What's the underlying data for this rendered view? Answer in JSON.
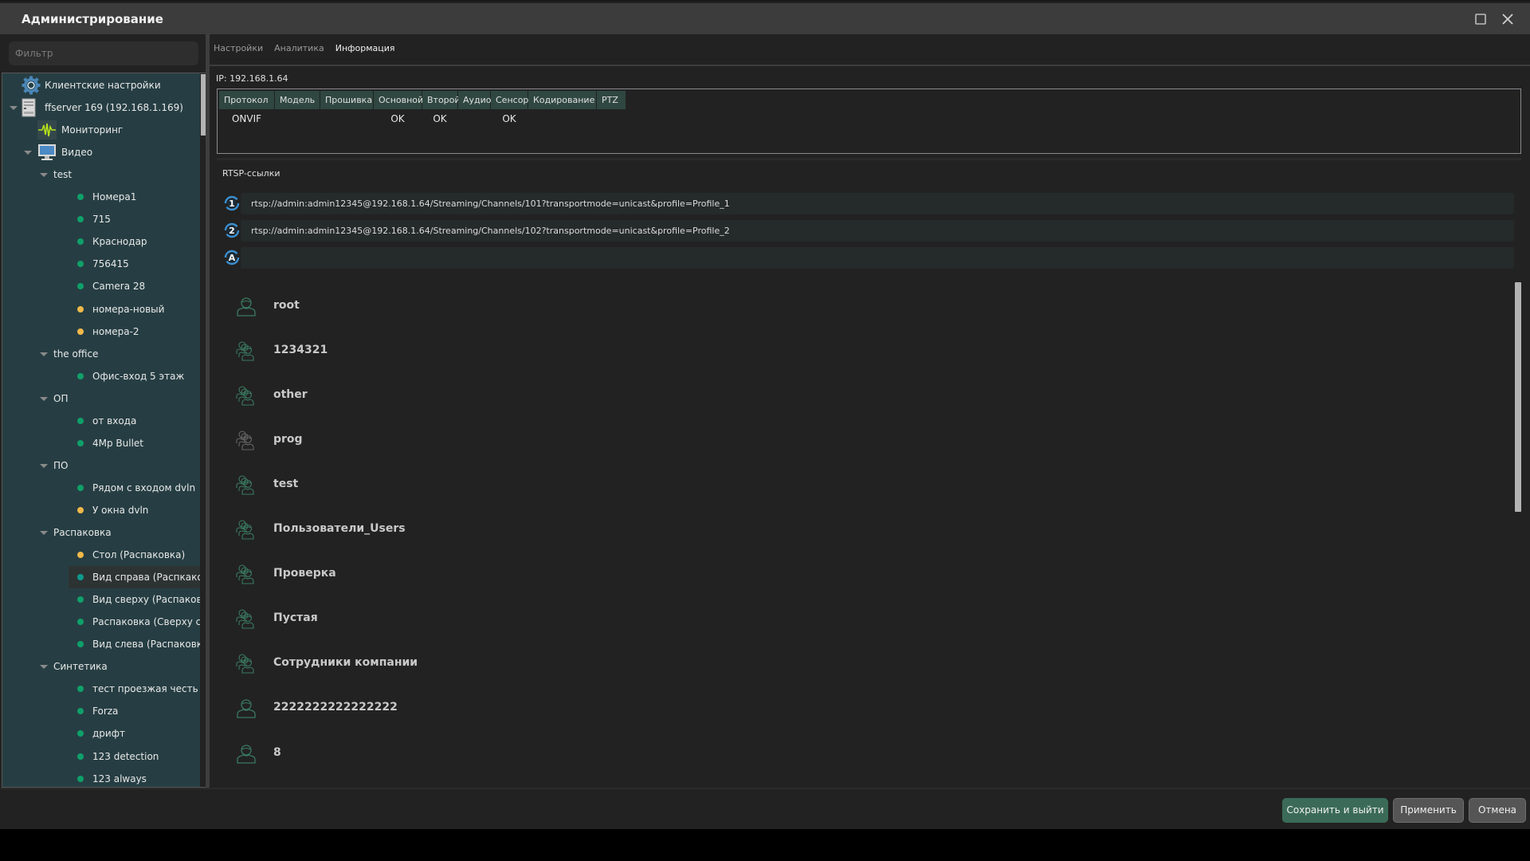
{
  "window": {
    "title": "Администрирование"
  },
  "sidebar": {
    "filter_placeholder": "Фильтр",
    "tree": [
      {
        "label": "Клиентские настройки",
        "type": "settings",
        "level": 0
      },
      {
        "label": "ffserver 169 (192.168.1.169)",
        "type": "server",
        "level": 0,
        "expanded": true
      },
      {
        "label": "Мониторинг",
        "type": "monitoring",
        "level": 1
      },
      {
        "label": "Видео",
        "type": "video",
        "level": 1,
        "expanded": true
      },
      {
        "label": "test",
        "type": "group",
        "level": 2,
        "expanded": true
      },
      {
        "label": "Номера1",
        "type": "camera",
        "status": "online",
        "level": 3
      },
      {
        "label": "715",
        "type": "camera",
        "status": "online",
        "level": 3
      },
      {
        "label": "Краснодар",
        "type": "camera",
        "status": "online",
        "level": 3
      },
      {
        "label": "756415",
        "type": "camera",
        "status": "online",
        "level": 3
      },
      {
        "label": "Camera 28",
        "type": "camera",
        "status": "online",
        "level": 3
      },
      {
        "label": "номера-новый",
        "type": "camera",
        "status": "warning",
        "level": 3
      },
      {
        "label": "номера-2",
        "type": "camera",
        "status": "warning",
        "level": 3
      },
      {
        "label": "the office",
        "type": "group",
        "level": 2,
        "expanded": true
      },
      {
        "label": "Офис-вход 5 этаж",
        "type": "camera",
        "status": "online",
        "level": 3
      },
      {
        "label": "ОП",
        "type": "group",
        "level": 2,
        "expanded": true
      },
      {
        "label": "от входа",
        "type": "camera",
        "status": "online",
        "level": 3
      },
      {
        "label": "4Mp Bullet",
        "type": "camera",
        "status": "online",
        "level": 3
      },
      {
        "label": "ПО",
        "type": "group",
        "level": 2,
        "expanded": true
      },
      {
        "label": "Рядом с входом dvln",
        "type": "camera",
        "status": "online",
        "level": 3
      },
      {
        "label": "У окна dvln",
        "type": "camera",
        "status": "warning",
        "level": 3
      },
      {
        "label": "Распаковка",
        "type": "group",
        "level": 2,
        "expanded": true
      },
      {
        "label": "Стол (Распаковка)",
        "type": "camera",
        "status": "warning",
        "level": 3
      },
      {
        "label": "Вид справа (Распкако...",
        "type": "camera",
        "status": "selected",
        "level": 3,
        "selected": true
      },
      {
        "label": "Вид сверху (Распаков...",
        "type": "camera",
        "status": "online",
        "level": 3
      },
      {
        "label": "Распаковка (Сверху с...",
        "type": "camera",
        "status": "online",
        "level": 3
      },
      {
        "label": "Вид слева (Распаковк...",
        "type": "camera",
        "status": "online",
        "level": 3
      },
      {
        "label": "Синтетика",
        "type": "group",
        "level": 2,
        "expanded": true
      },
      {
        "label": "тест проезжая честь",
        "type": "camera",
        "status": "online",
        "level": 3
      },
      {
        "label": "Forza",
        "type": "camera",
        "status": "online",
        "level": 3
      },
      {
        "label": "дрифт",
        "type": "camera",
        "status": "online",
        "level": 3
      },
      {
        "label": "123 detection",
        "type": "camera",
        "status": "online",
        "level": 3
      },
      {
        "label": "123 always",
        "type": "camera",
        "status": "online",
        "level": 3
      }
    ]
  },
  "tabs": [
    {
      "label": "Настройки",
      "active": false
    },
    {
      "label": "Аналитика",
      "active": false
    },
    {
      "label": "Информация",
      "active": true
    }
  ],
  "info": {
    "ip_label": "IP: 192.168.1.64",
    "columns": [
      "Протокол",
      "Модель",
      "Прошивка",
      "Основной",
      "Второй",
      "Аудио",
      "Сенсор",
      "Кодирование",
      "PTZ"
    ],
    "row": [
      "ONVIF",
      "",
      "",
      "OK",
      "OK",
      "",
      "OK",
      "",
      ""
    ]
  },
  "rtsp": {
    "label": "RTSP-ссылки",
    "links": [
      {
        "badge": "1",
        "url": "rtsp://admin:admin12345@192.168.1.64/Streaming/Channels/101?transportmode=unicast&profile=Profile_1"
      },
      {
        "badge": "2",
        "url": "rtsp://admin:admin12345@192.168.1.64/Streaming/Channels/102?transportmode=unicast&profile=Profile_2"
      },
      {
        "badge": "A",
        "url": ""
      }
    ]
  },
  "users": [
    {
      "name": "root",
      "kind": "user",
      "active": true
    },
    {
      "name": "1234321",
      "kind": "group",
      "active": true
    },
    {
      "name": "other",
      "kind": "group",
      "active": true
    },
    {
      "name": "prog",
      "kind": "group",
      "active": false
    },
    {
      "name": "test",
      "kind": "group",
      "active": true
    },
    {
      "name": "Пользователи_Users",
      "kind": "group",
      "active": true
    },
    {
      "name": "Проверка",
      "kind": "group",
      "active": true
    },
    {
      "name": "Пустая",
      "kind": "group",
      "active": true
    },
    {
      "name": "Сотрудники компании",
      "kind": "group",
      "active": true
    },
    {
      "name": "2222222222222222",
      "kind": "user",
      "active": true
    },
    {
      "name": "8",
      "kind": "user",
      "active": true
    }
  ],
  "buttons": {
    "save_exit": "Сохранить и выйти",
    "apply": "Применить",
    "cancel": "Отмена"
  },
  "colors": {
    "status_online": "#0fa06a",
    "status_warning": "#f0b94a",
    "status_selected": "#0f9a8e",
    "user_icon_active": "#3a7a62",
    "user_icon_inactive": "#666666",
    "primary_button": "#3b6b58",
    "tree_bg": "#263e43"
  }
}
